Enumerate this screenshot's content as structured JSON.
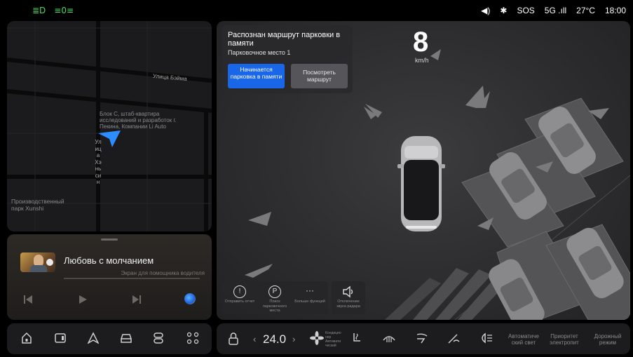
{
  "status_bar": {
    "left_icons": [
      "low-beam-icon",
      "parking-light-icon"
    ],
    "sos": "SOS",
    "network": "5G",
    "temperature": "27°C",
    "time": "18:00"
  },
  "map": {
    "street_top": "Улица Бэйма",
    "street_vertical": "Улица Хэньсин",
    "poi_building": "Блок C, штаб-квартира исследований и разработок г. Пекина, Компании Li Auto",
    "poi_park": "Производственный парк Xunshi"
  },
  "music": {
    "title": "Любовь с молчанием",
    "subtitle": "Экран для помощника водителя"
  },
  "parking_popup": {
    "title": "Распознан маршрут парковки в памяти",
    "subtitle": "Парковочное место 1",
    "primary_button": "Начинается парковка в памяти",
    "secondary_button": "Посмотреть маршрут"
  },
  "speed": {
    "value": "8",
    "unit": "km/h"
  },
  "scene_actions": [
    {
      "icon": "!",
      "label": "Отправить отчет"
    },
    {
      "icon": "P",
      "label": "Поиск парковочного места"
    },
    {
      "icon": "···",
      "label": "Больше функций"
    },
    {
      "icon": "speaker-icon",
      "label": "Отключение звука радара"
    }
  ],
  "climate": {
    "temperature": "24.0",
    "ac_mode_label": "Кондицио нер Автомати ческий"
  },
  "right_labels": {
    "auto_light": "Автоматиче ский свет",
    "priority": "Приоритет электропит",
    "road_mode": "Дорожный режим"
  }
}
